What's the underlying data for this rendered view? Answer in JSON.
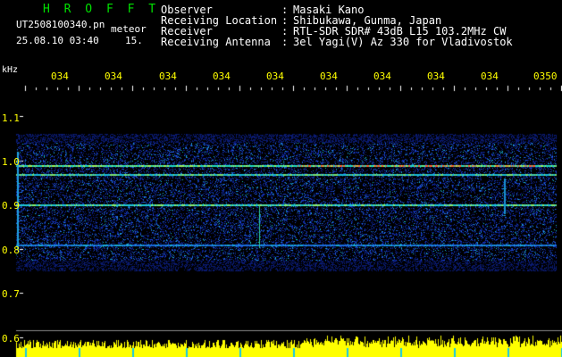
{
  "app": {
    "name": "H R O F F T"
  },
  "meta": {
    "filename": "UT2508100340.pn",
    "mode": "meteor",
    "date_time": "25.08.10 03:40",
    "count": "15."
  },
  "station": [
    {
      "label": "Observer",
      "sep": ":",
      "value": "Masaki Kano"
    },
    {
      "label": "Receiving Location",
      "sep": ":",
      "value": "Shibukawa, Gunma, Japan"
    },
    {
      "label": "Receiver",
      "sep": ":",
      "value": "RTL-SDR SDR# 43dB L15 103.2MHz CW"
    },
    {
      "label": "Receiving Antenna",
      "sep": ":",
      "value": "3el Yagi(V) Az 330 for Vladivostok"
    }
  ],
  "time_axis": {
    "labels": [
      "034",
      "034",
      "034",
      "034",
      "034",
      "034",
      "034",
      "034",
      "034",
      "0350"
    ]
  },
  "freq_axis": {
    "unit": "kHz",
    "ticks": [
      "1.1",
      "1.0",
      "0.9",
      "0.8",
      "0.7",
      "0.6"
    ]
  },
  "colors": {
    "background": "#000000",
    "time_labels": "#ffff00",
    "title": "#00e000",
    "text": "#ffffff",
    "level_bar": "#ffff00"
  }
}
